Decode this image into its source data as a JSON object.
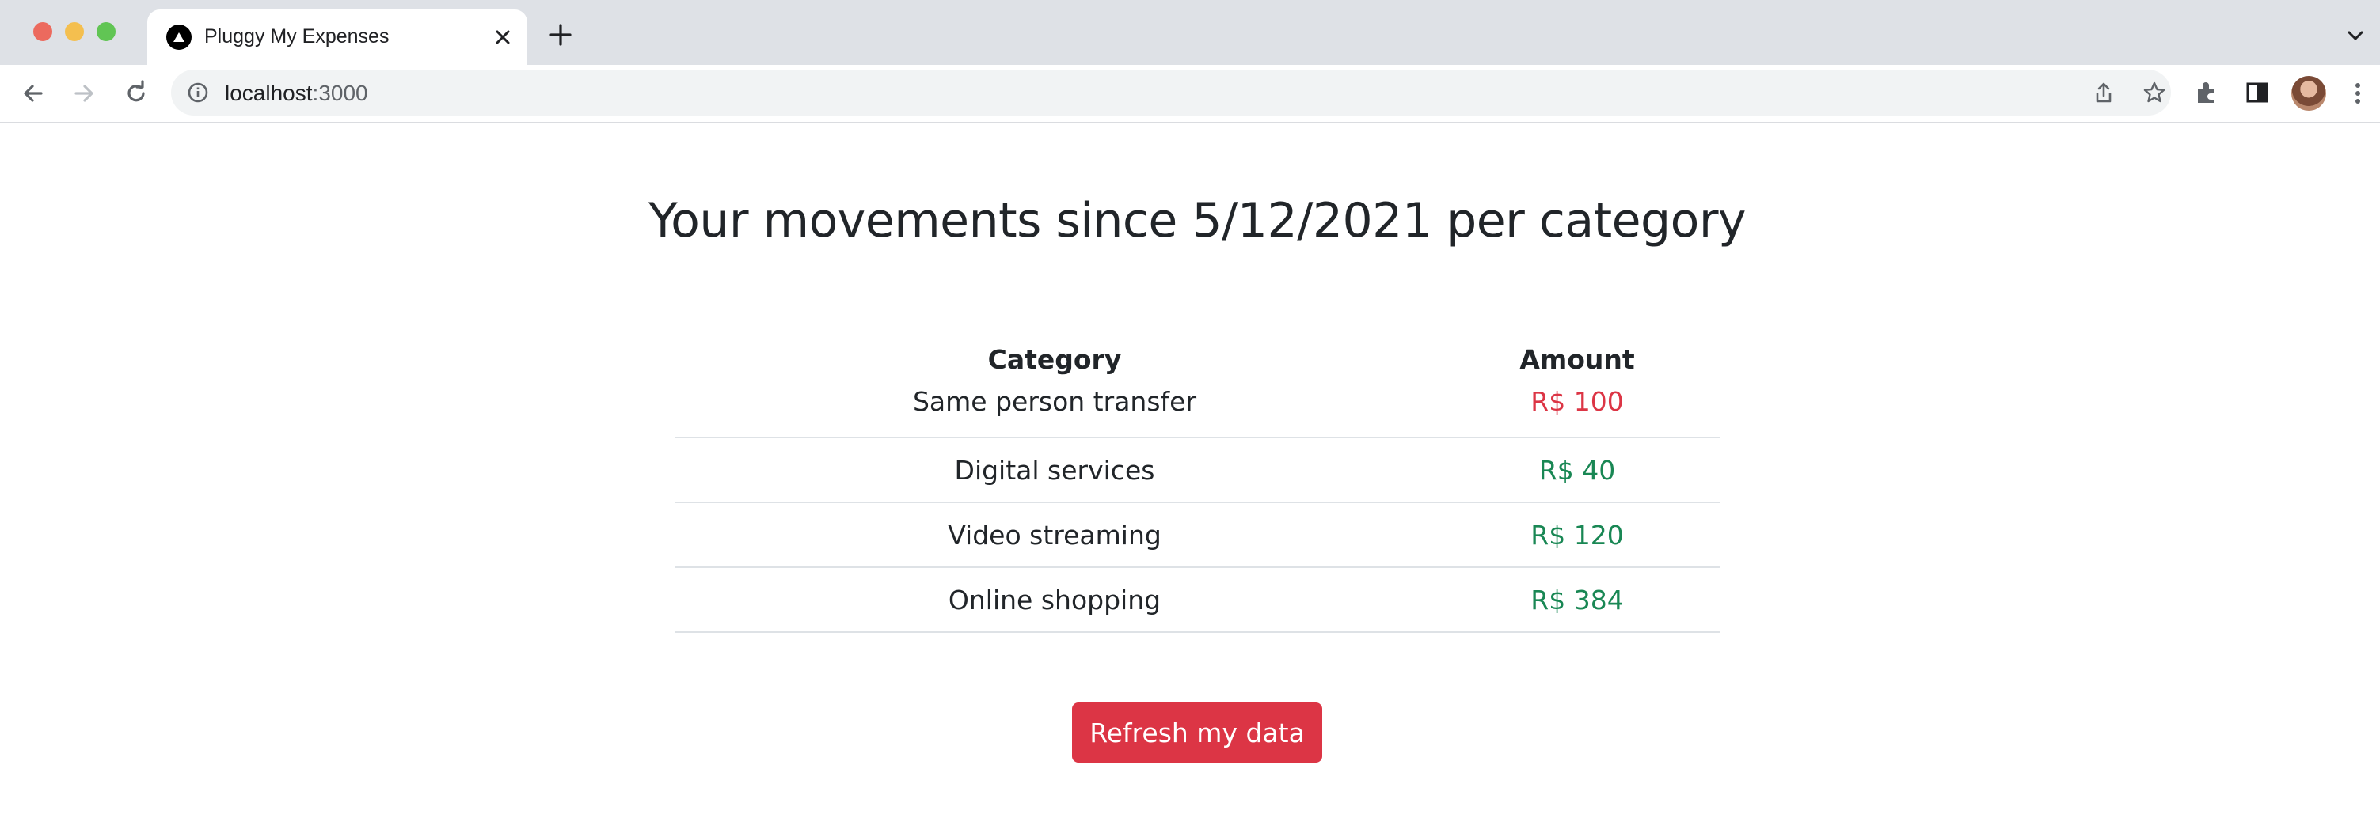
{
  "browser": {
    "tab_title": "Pluggy My Expenses",
    "url_host": "localhost",
    "url_port": ":3000",
    "icons": [
      "back-icon",
      "forward-icon",
      "reload-icon",
      "info-icon",
      "share-icon",
      "star-icon",
      "extensions-icon",
      "side-panel-icon",
      "profile-avatar",
      "more-icon",
      "close-icon",
      "new-tab-icon",
      "tab-search-icon"
    ]
  },
  "page": {
    "title": "Your movements since 5/12/2021 per category",
    "table": {
      "headers": [
        "Category",
        "Amount"
      ],
      "rows": [
        {
          "category": "Same person transfer",
          "amount": "R$ 100",
          "status": "negative"
        },
        {
          "category": "Digital services",
          "amount": "R$ 40",
          "status": "positive"
        },
        {
          "category": "Video streaming",
          "amount": "R$ 120",
          "status": "positive"
        },
        {
          "category": "Online shopping",
          "amount": "R$ 384",
          "status": "positive"
        }
      ]
    },
    "refresh_button": "Refresh my data"
  },
  "colors": {
    "negative": "#dc3545",
    "positive": "#198754",
    "button": "#dc3545"
  }
}
